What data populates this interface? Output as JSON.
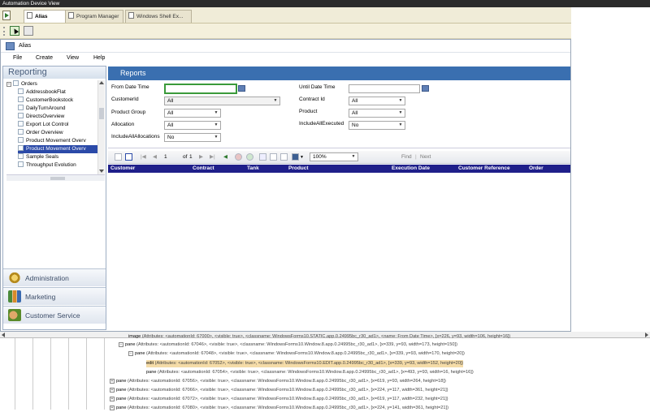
{
  "app_title": "Automation Device View",
  "tabs": [
    {
      "label": "Alias",
      "active": true
    },
    {
      "label": "Program Manager",
      "active": false
    },
    {
      "label": "Windows Shell Ex...",
      "active": false
    }
  ],
  "window": {
    "title": "Alias",
    "menu": [
      "File",
      "Create",
      "View",
      "Help"
    ]
  },
  "left_panel": {
    "header": "Reporting",
    "tree_root": "Orders",
    "tree_items": [
      "AddressbookFlat",
      "CustomerBookstock",
      "DailyTurnAround",
      "DirectsOverview",
      "Export Lot Control",
      "Order Overview",
      "Product Movement Overv",
      "Product Movement Overv",
      "Sample Seals",
      "Throughput Evolution"
    ],
    "selected_index": 7,
    "nav_buttons": [
      {
        "label": "Administration",
        "icon": "gear-icon"
      },
      {
        "label": "Marketing",
        "icon": "chart-icon"
      },
      {
        "label": "Customer Service",
        "icon": "hands-icon"
      }
    ]
  },
  "reports": {
    "header": "Reports",
    "params_left": [
      {
        "label": "From Date Time",
        "value": "",
        "kind": "date"
      },
      {
        "label": "CustomerId",
        "value": "All",
        "kind": "select"
      },
      {
        "label": "Product Group",
        "value": "All",
        "kind": "select"
      },
      {
        "label": "Allocation",
        "value": "All",
        "kind": "select"
      },
      {
        "label": "IncludeAllAllocations",
        "value": "No",
        "kind": "select"
      }
    ],
    "params_right": [
      {
        "label": "Until Date Time",
        "value": "",
        "kind": "date"
      },
      {
        "label": "Contract Id",
        "value": "All",
        "kind": "select"
      },
      {
        "label": "Product",
        "value": "All",
        "kind": "select"
      },
      {
        "label": "IncludeAllExecuted",
        "value": "No",
        "kind": "select"
      }
    ],
    "toolbar": {
      "page": "1",
      "of_label": "of",
      "total_pages": "1",
      "zoom": "100%",
      "find": "Find",
      "separator": "|",
      "next": "Next"
    },
    "columns": [
      "Customer",
      "Contract",
      "Tank",
      "Product",
      "Execution Date",
      "Customer Reference",
      "Order"
    ]
  },
  "inspector": {
    "rows": [
      {
        "kind": "image",
        "text": "(Attributes: <automationId: 67000>, <visible: true>, <classname: WindowsForms10.STATIC.app.0.24995bc_r30_ad1>, <name: From Date Time>, [x=226, y=93, width=106, height=16])",
        "expander": "",
        "highlight": false
      },
      {
        "kind": "pane",
        "text": "(Attributes: <automationId: 67046>, <visible: true>, <classname: WindowsForms10.Window.8.app.0.24995bc_r30_ad1>, [x=339, y=93, width=173, height=150])",
        "expander": "−",
        "highlight": false
      },
      {
        "kind": "pane",
        "text": "(Attributes: <automationId: 67048>, <visible: true>, <classname: WindowsForms10.Window.8.app.0.24995bc_r30_ad1>, [x=339, y=93, width=170, height=20])",
        "expander": "−",
        "highlight": false
      },
      {
        "kind": "edit",
        "text": "(Attributes: <automationId: 67052>, <visible: true>, <classname: WindowsForms10.EDIT.app.0.24995bc_r30_ad1>, [x=339, y=93, width=152, height=20])",
        "expander": "",
        "highlight": true
      },
      {
        "kind": "pane",
        "text": "(Attributes: <automationId: 67054>, <visible: true>, <classname: WindowsForms10.Window.8.app.0.24995bc_r30_ad1>, [x=493, y=93, width=16, height=16])",
        "expander": "",
        "highlight": false
      },
      {
        "kind": "pane",
        "text": "(Attributes: <automationId: 67056>, <visible: true>, <classname: WindowsForms10.Window.8.app.0.24995bc_r30_ad1>, [x=619, y=93, width=264, height=18])",
        "expander": "+",
        "highlight": false
      },
      {
        "kind": "pane",
        "text": "(Attributes: <automationId: 67066>, <visible: true>, <classname: WindowsForms10.Window.8.app.0.24995bc_r30_ad1>, [x=224, y=117, width=361, height=21])",
        "expander": "+",
        "highlight": false
      },
      {
        "kind": "pane",
        "text": "(Attributes: <automationId: 67072>, <visible: true>, <classname: WindowsForms10.Window.8.app.0.24995bc_r30_ad1>, [x=619, y=117, width=232, height=21])",
        "expander": "+",
        "highlight": false
      },
      {
        "kind": "pane",
        "text": "(Attributes: <automationId: 67080>, <visible: true>, <classname: WindowsForms10.Window.8.app.0.24995bc_r30_ad1>, [x=224, y=141, width=361, height=21])",
        "expander": "+",
        "highlight": false
      }
    ]
  },
  "colors": {
    "reports_header": "#3a6fb0",
    "column_header": "#1f1f8a",
    "selected_tree_item": "#2b4aa8",
    "highlight_row": "#f5dca8",
    "focused_input_border": "#3a9a3a"
  }
}
